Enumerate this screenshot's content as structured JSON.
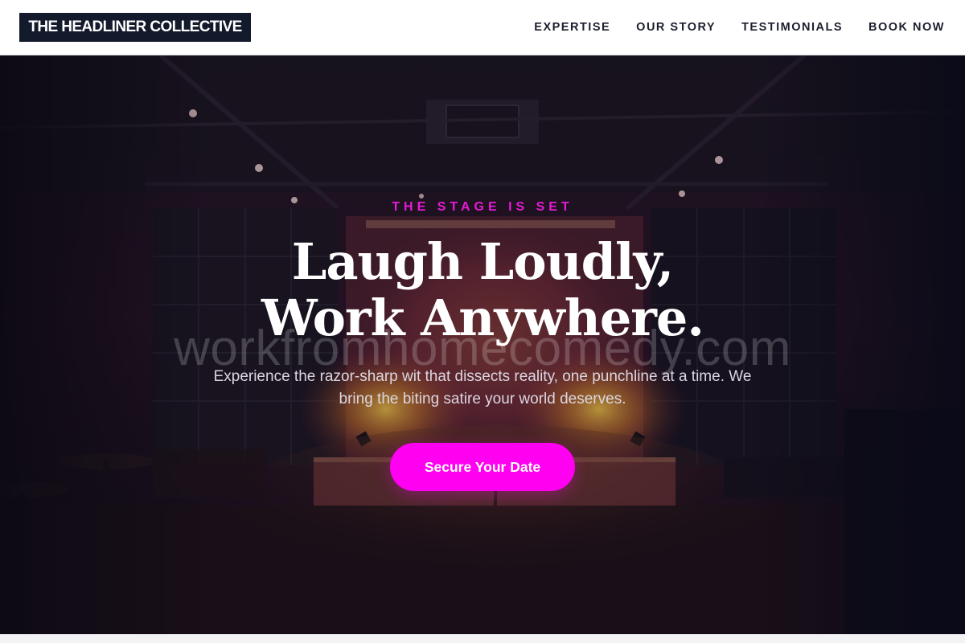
{
  "header": {
    "brand": "THE HEADLINER COLLECTIVE",
    "nav": [
      {
        "label": "EXPERTISE"
      },
      {
        "label": "OUR STORY"
      },
      {
        "label": "TESTIMONIALS"
      },
      {
        "label": "BOOK NOW"
      }
    ]
  },
  "hero": {
    "eyebrow": "THE STAGE IS SET",
    "headline_line1": "Laugh Loudly,",
    "headline_line2": "Work Anywhere.",
    "watermark": "workfromhomecomedy.com",
    "subtext": "Experience the razor-sharp wit that dissects reality, one punchline at a time. We bring the biting satire your world deserves.",
    "cta_label": "Secure Your Date"
  },
  "colors": {
    "brand_bg": "#131a2c",
    "accent": "#ff00f0",
    "eyebrow": "#e61bd6",
    "nav_text": "#1c1f2e"
  }
}
